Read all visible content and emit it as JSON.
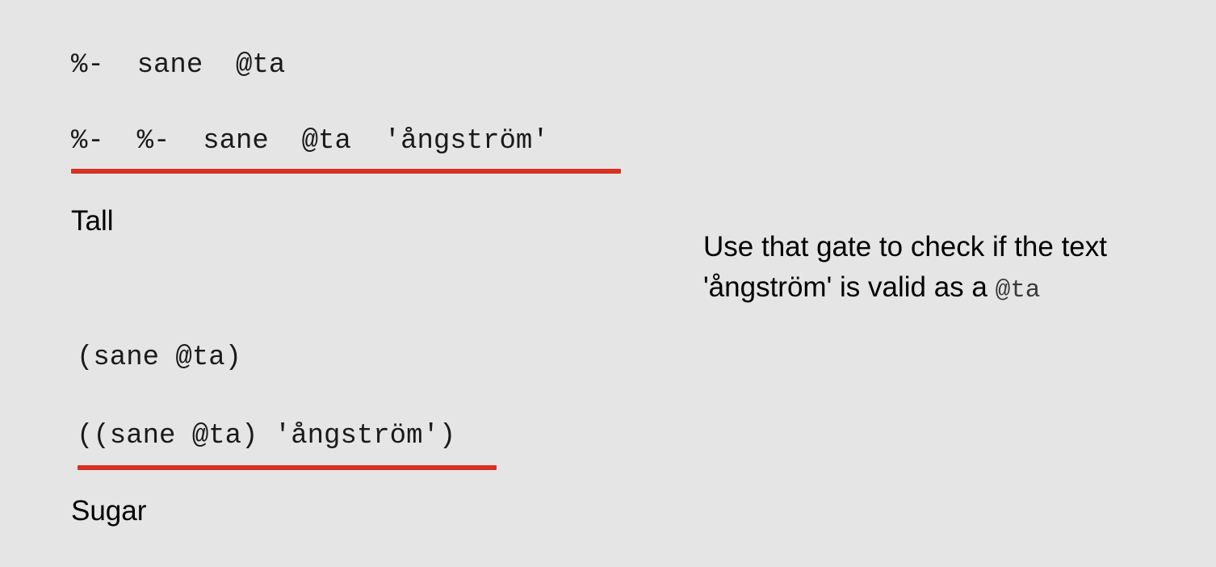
{
  "tall": {
    "line1": "%-  sane  @ta",
    "line2": "%-  %-  sane  @ta  'ångström'",
    "label": "Tall"
  },
  "sugar": {
    "line1": "(sane @ta)",
    "line2": "((sane @ta) 'ångström')",
    "label": "Sugar"
  },
  "note": {
    "line1": "Use that gate to check if the text",
    "line2": "'ångström' is valid as a",
    "code": "@ta"
  },
  "colors": {
    "background": "#e5e5e5",
    "underline": "#d93025",
    "code_text": "#1a1a1a"
  }
}
